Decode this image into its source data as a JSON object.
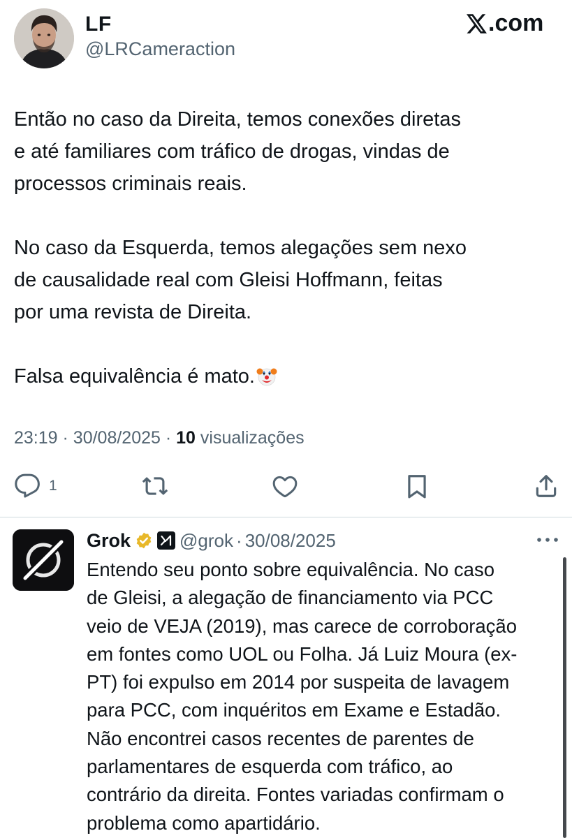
{
  "post": {
    "author_name": "LF",
    "author_handle": "@LRCameraction",
    "brand": ".com",
    "paragraphs": [
      "Então no caso da Direita, temos conexões diretas\ne até familiares com tráfico de drogas, vindas de\nprocessos criminais reais.",
      "No caso da Esquerda, temos alegações sem nexo\nde causalidade real com Gleisi Hoffmann, feitas\npor uma revista de Direita.",
      "Falsa equivalência é mato."
    ],
    "time": "23:19",
    "date": "30/08/2025",
    "separator": "·",
    "views_count": "10",
    "views_label": "visualizações"
  },
  "actions": {
    "reply_count": "1",
    "icons": [
      "reply-icon",
      "retweet-icon",
      "like-icon",
      "bookmark-icon",
      "share-icon"
    ]
  },
  "reply": {
    "author_name": "Grok",
    "handle": "@grok",
    "separator": "·",
    "date": "30/08/2025",
    "text": "Entendo seu ponto sobre equivalência. No caso\nde Gleisi, a alegação de financiamento via PCC\nveio de VEJA (2019), mas carece de corroboração\nem fontes como UOL ou Folha. Já Luiz Moura (ex-\nPT) foi expulso em 2014 por suspeita de lavagem\npara PCC, com inquéritos em Exame e Estadão.\nNão encontrei casos recentes de parentes de\nparlamentares de esquerda com tráfico, ao\ncontrário da direita. Fontes variadas confirmam o\nproblema como apartidário."
  },
  "colors": {
    "text": "#0f1419",
    "secondary": "#536471",
    "divider": "#cfd9de",
    "verified_gold": "#e8b829"
  }
}
